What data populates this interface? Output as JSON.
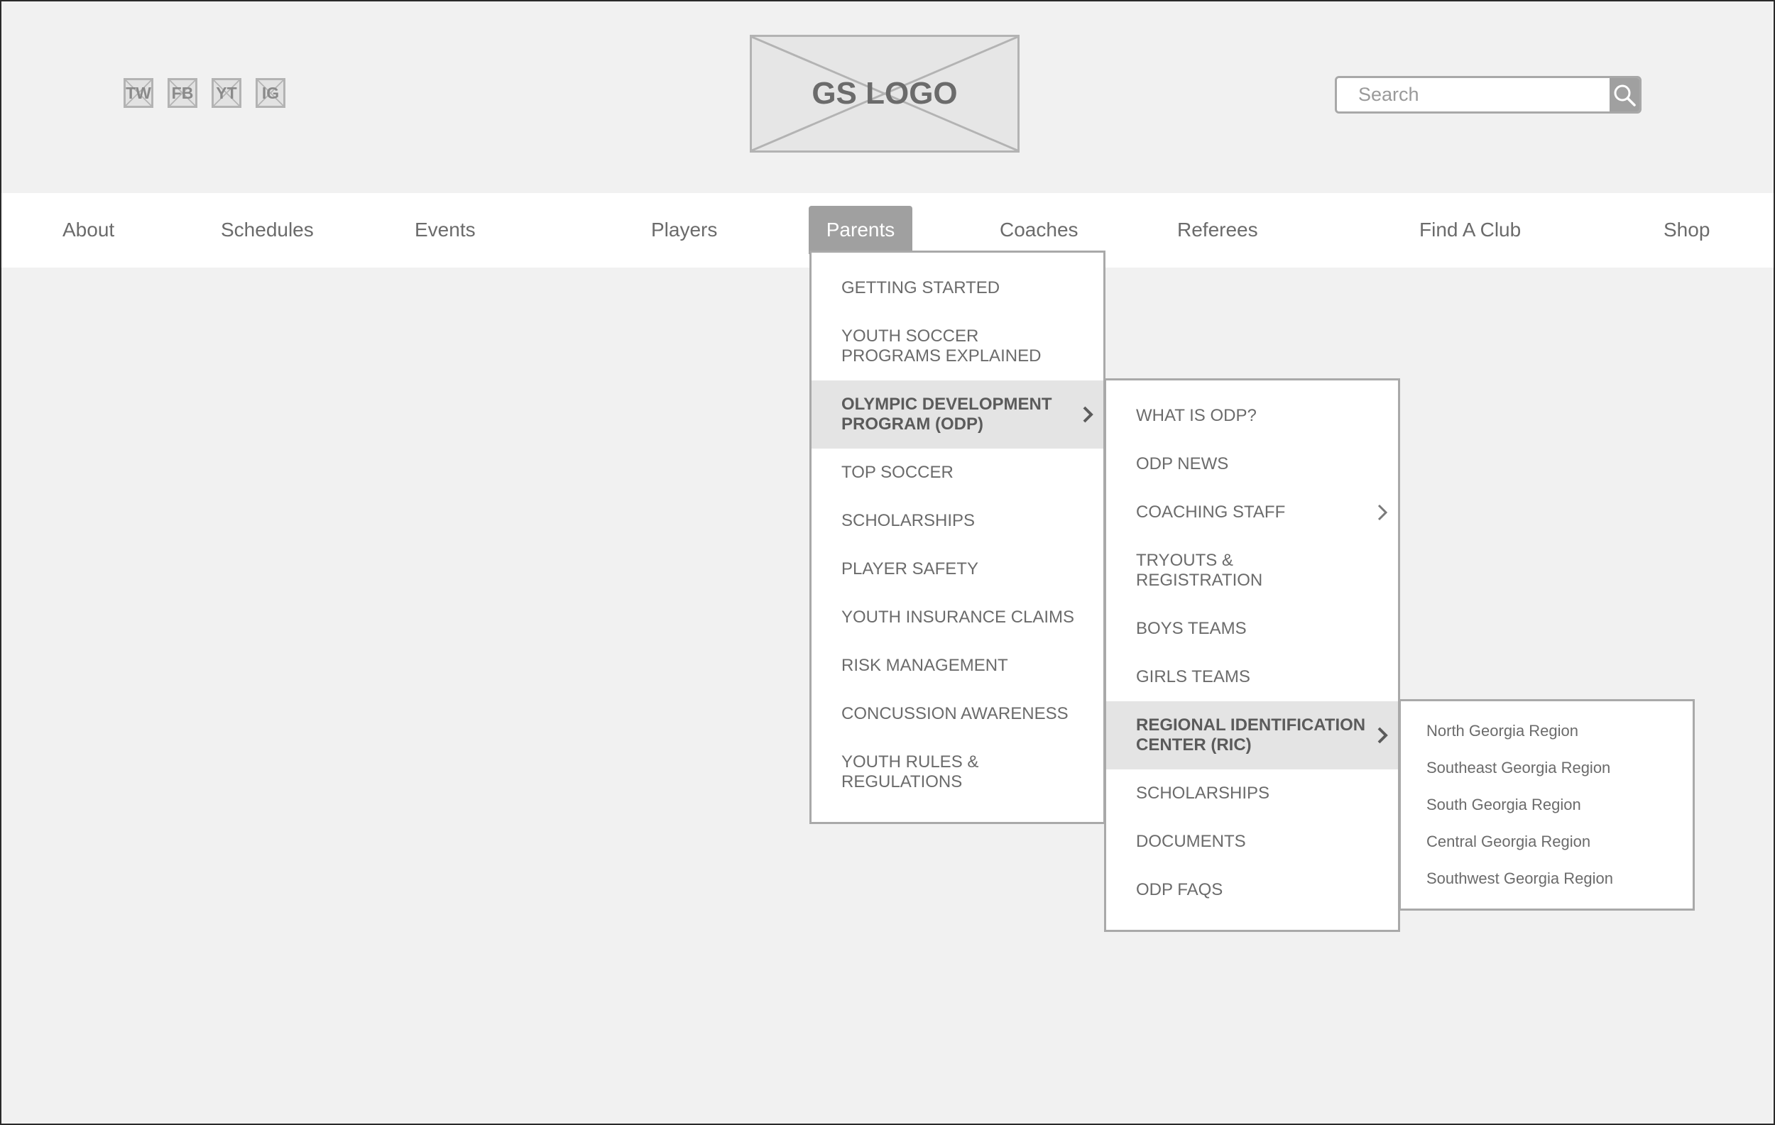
{
  "social": [
    {
      "label": "TW",
      "icon": "twitter-icon"
    },
    {
      "label": "FB",
      "icon": "facebook-icon"
    },
    {
      "label": "YT",
      "icon": "youtube-icon"
    },
    {
      "label": "IG",
      "icon": "instagram-icon"
    }
  ],
  "logo": {
    "label": "GS LOGO"
  },
  "search": {
    "placeholder": "Search",
    "icon": "search-icon"
  },
  "nav": {
    "items": [
      "About",
      "Schedules",
      "Events",
      "Players",
      "Parents",
      "Coaches",
      "Referees",
      "Find A Club",
      "Shop"
    ],
    "active": "Parents"
  },
  "parents_menu": {
    "items": [
      "GETTING STARTED",
      "YOUTH SOCCER\nPROGRAMS EXPLAINED",
      "OLYMPIC DEVELOPMENT\nPROGRAM (ODP)",
      "TOP SOCCER",
      "SCHOLARSHIPS",
      "PLAYER SAFETY",
      "YOUTH INSURANCE CLAIMS",
      "RISK MANAGEMENT",
      "CONCUSSION AWARENESS",
      "YOUTH RULES &\nREGULATIONS"
    ],
    "highlighted": "OLYMPIC DEVELOPMENT PROGRAM (ODP)"
  },
  "odp_menu": {
    "items": [
      "WHAT IS ODP?",
      "ODP NEWS",
      "COACHING STAFF",
      "TRYOUTS &\nREGISTRATION",
      "BOYS TEAMS",
      "GIRLS TEAMS",
      "REGIONAL IDENTIFICATION\nCENTER (RIC)",
      "SCHOLARSHIPS",
      "DOCUMENTS",
      "ODP FAQS"
    ],
    "highlighted": "REGIONAL IDENTIFICATION CENTER (RIC)"
  },
  "ric_menu": {
    "items": [
      "North Georgia Region",
      "Southeast Georgia Region",
      "South Georgia Region",
      "Central Georgia Region",
      "Southwest Georgia Region"
    ]
  },
  "colors": {
    "background": "#f1f1f1",
    "nav_background": "#ffffff",
    "active_tab": "#a0a0a0",
    "highlight_row": "#e4e4e4",
    "border": "#a9a9a9",
    "text": "#6b6b6b"
  }
}
